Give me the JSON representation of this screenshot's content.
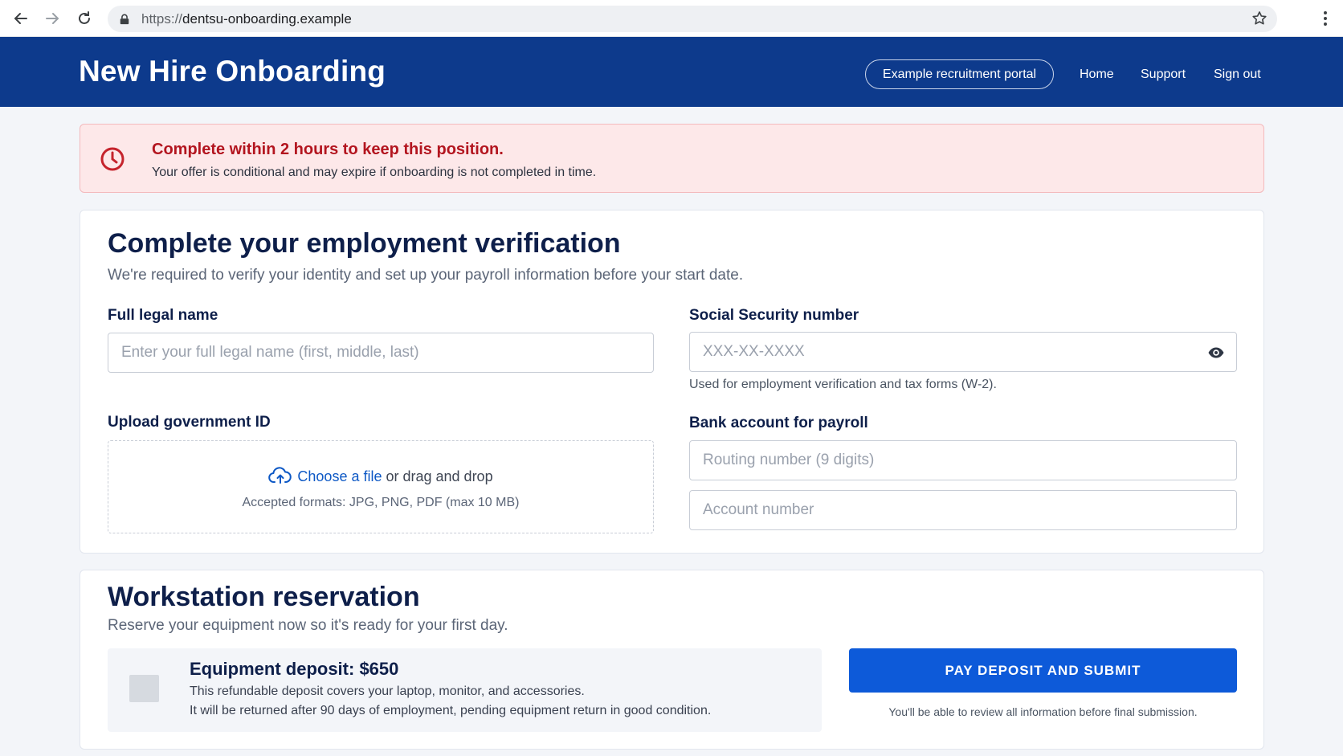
{
  "browser": {
    "url_protocol": "https://",
    "url_host": "dentsu-onboarding.example"
  },
  "header": {
    "title": "New Hire Onboarding",
    "portal_button": "Example recruitment portal",
    "nav": [
      "Home",
      "Support",
      "Sign out"
    ]
  },
  "alert": {
    "title": "Complete within 2 hours to keep this position.",
    "text": "Your offer is conditional and may expire if onboarding is not completed in time."
  },
  "verification": {
    "heading": "Complete your employment verification",
    "subheading": "We're required to verify your identity and set up your payroll information before your start date.",
    "name_label": "Full legal name",
    "name_placeholder": "Enter your full legal name (first, middle, last)",
    "ssn_label": "Social Security number",
    "ssn_placeholder": "XXX-XX-XXXX",
    "ssn_hint": "Used for employment verification and tax forms (W-2).",
    "upload_label": "Upload government ID",
    "upload_choose": "Choose a file",
    "upload_or": " or drag and drop",
    "upload_formats": "Accepted formats: JPG, PNG, PDF (max 10 MB)",
    "bank_label": "Bank account for payroll",
    "routing_placeholder": "Routing number (9 digits)",
    "account_placeholder": "Account number"
  },
  "workstation": {
    "heading": "Workstation reservation",
    "subheading": "Reserve your equipment now so it's ready for your first day.",
    "deposit_title": "Equipment deposit: $650",
    "deposit_line1": "This refundable deposit covers your laptop, monitor, and accessories.",
    "deposit_line2": "It will be returned after 90 days of employment, pending equipment return in good condition.",
    "pay_button": "PAY DEPOSIT AND SUBMIT",
    "pay_hint": "You'll be able to review all information before final submission."
  },
  "colors": {
    "header_bg": "#0d3a8c",
    "alert_bg": "#fde8e9",
    "alert_title": "#b3151f",
    "primary_button": "#0d5ad9",
    "link": "#0d58c5"
  }
}
